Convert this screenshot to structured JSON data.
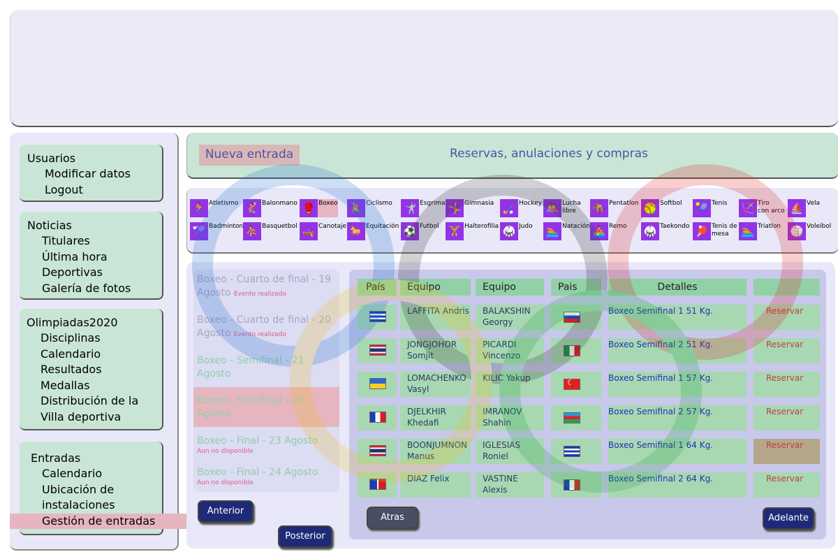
{
  "page_title": "Reservas, anulaciones y compras",
  "nueva_entrada": "Nueva entrada",
  "sidebar": {
    "usuarios": {
      "title": "Usuarios",
      "items": [
        "Modificar datos",
        "Logout"
      ]
    },
    "noticias": {
      "title": "Noticias",
      "items": [
        "Titulares",
        "Última hora",
        "Deportivas",
        "Galería de fotos"
      ]
    },
    "olimpiadas": {
      "title": "Olimpiadas2020",
      "items": [
        "Disciplinas",
        "Calendario",
        "Resultados",
        "Medallas",
        "Distribución de la",
        "Villa deportiva"
      ]
    },
    "entradas": {
      "title": "Entradas",
      "items": [
        "Calendario",
        "Ubicación de",
        "instalaciones",
        "Gestión de entradas"
      ],
      "selected_index": 3
    }
  },
  "sports_row1": [
    {
      "icon": "athletics-icon",
      "glyph": "🏃",
      "label": "Atletismo",
      "label2": ""
    },
    {
      "icon": "handball-icon",
      "glyph": "🤾",
      "label": "Balonmano",
      "label2": ""
    },
    {
      "icon": "boxing-icon",
      "glyph": "🥊",
      "label": "Boxeo",
      "label2": "",
      "selected": true
    },
    {
      "icon": "cycling-icon",
      "glyph": "🚴",
      "label": "Ciclismo",
      "label2": ""
    },
    {
      "icon": "fencing-icon",
      "glyph": "🤺",
      "label": "Esgrima",
      "label2": ""
    },
    {
      "icon": "gymnastics-icon",
      "glyph": "🤸",
      "label": "Gimnasia",
      "label2": ""
    },
    {
      "icon": "hockey-icon",
      "glyph": "🏑",
      "label": "Hockey",
      "label2": ""
    },
    {
      "icon": "wrestling-icon",
      "glyph": "🤼",
      "label": "Lucha",
      "label2": "libre"
    },
    {
      "icon": "pentathlon-icon",
      "glyph": "🏇",
      "label": "Pentatlon",
      "label2": ""
    },
    {
      "icon": "softball-icon",
      "glyph": "🥎",
      "label": "Softbol",
      "label2": ""
    },
    {
      "icon": "tennis-icon",
      "glyph": "🎾",
      "label": "Tenis",
      "label2": ""
    },
    {
      "icon": "archery-icon",
      "glyph": "🏹",
      "label": "Tiro",
      "label2": "con arco"
    },
    {
      "icon": "sailing-icon",
      "glyph": "⛵",
      "label": "Vela",
      "label2": ""
    }
  ],
  "sports_row2": [
    {
      "icon": "badminton-icon",
      "glyph": "🏸",
      "label": "Badminton",
      "label2": ""
    },
    {
      "icon": "basketball-icon",
      "glyph": "⛹",
      "label": "Basquetbol",
      "label2": ""
    },
    {
      "icon": "canoeing-icon",
      "glyph": "🛶",
      "label": "Canotaje",
      "label2": ""
    },
    {
      "icon": "equestrian-icon",
      "glyph": "🐎",
      "label": "Equitación",
      "label2": ""
    },
    {
      "icon": "football-icon",
      "glyph": "⚽",
      "label": "Futbol",
      "label2": ""
    },
    {
      "icon": "weightlifting-icon",
      "glyph": "🏋",
      "label": "Halterofilia",
      "label2": ""
    },
    {
      "icon": "judo-icon",
      "glyph": "🥋",
      "label": "Judo",
      "label2": ""
    },
    {
      "icon": "swimming-icon",
      "glyph": "🏊",
      "label": "Natación",
      "label2": ""
    },
    {
      "icon": "rowing-icon",
      "glyph": "🚣",
      "label": "Remo",
      "label2": ""
    },
    {
      "icon": "taekwondo-icon",
      "glyph": "🥋",
      "label": "Taekondo",
      "label2": ""
    },
    {
      "icon": "table-tennis-icon",
      "glyph": "🏓",
      "label": "Tenis de",
      "label2": "mesa"
    },
    {
      "icon": "triathlon-icon",
      "glyph": "🏊",
      "label": "Triatlon",
      "label2": ""
    },
    {
      "icon": "volleyball-icon",
      "glyph": "🏐",
      "label": "Voleibol",
      "label2": ""
    }
  ],
  "events": [
    {
      "l1": "Boxeo - Cuarto de final - 19",
      "l2": "Agosto",
      "tag": "Evento realizado",
      "state": "past"
    },
    {
      "l1": "Boxeo - Cuarto de final - 20",
      "l2": "Agosto",
      "tag": "Evento realizado",
      "state": "past"
    },
    {
      "l1": "Boxeo - Semifinal - 21",
      "l2": "Agosto",
      "tag": "",
      "state": "open"
    },
    {
      "l1": "Boxeo - Semifinal - 22",
      "l2": "Agosto",
      "tag": "",
      "state": "selected"
    },
    {
      "l1": "Boxeo - Final - 23 Agosto",
      "l2": "",
      "tag": "Aun no disponible",
      "state": "future"
    },
    {
      "l1": "Boxeo - Final - 24 Agosto",
      "l2": "",
      "tag": "Aun no disponible",
      "state": "future"
    }
  ],
  "buttons": {
    "anterior": "Anterior",
    "posterior": "Posterior",
    "atras": "Atras",
    "adelante": "Adelante"
  },
  "table": {
    "headers": [
      "País",
      "Equipo",
      "Equipo",
      "Pais",
      "Detalles"
    ],
    "rows": [
      {
        "flag1": "cuba",
        "team1": [
          "LAFFITA Andris",
          ""
        ],
        "team2": [
          "BALAKSHIN",
          "Georgy"
        ],
        "flag2": "russia",
        "detail": "Boxeo Semifinal 1 51 Kg.",
        "action": "Reservar"
      },
      {
        "flag1": "thailand",
        "team1": [
          "JONGJOHOR",
          "Somjit"
        ],
        "team2": [
          "PICARDI",
          "Vincenzo"
        ],
        "flag2": "italy",
        "detail": "Boxeo Semifinal 2 51 Kg.",
        "action": "Reservar"
      },
      {
        "flag1": "ukraine",
        "team1": [
          "LOMACHENKO",
          "Vasyl"
        ],
        "team2": [
          "KILIC Yakup",
          ""
        ],
        "flag2": "turkey",
        "detail": "Boxeo Semifinal 1 57 Kg.",
        "action": "Reservar"
      },
      {
        "flag1": "france",
        "team1": [
          "DJELKHIR",
          "Khedafi"
        ],
        "team2": [
          "IMRANOV",
          "Shahin"
        ],
        "flag2": "azerbaijan",
        "detail": "Boxeo Semifinal 2 57 Kg.",
        "action": "Reservar"
      },
      {
        "flag1": "thailand",
        "team1": [
          "BOONJUMNON",
          "Manus"
        ],
        "team2": [
          "IGLESIAS",
          "Roniel"
        ],
        "flag2": "cuba",
        "detail": "Boxeo Semifinal 1 64 Kg.",
        "action": "Reservar",
        "highlight": true
      },
      {
        "flag1": "dominican",
        "team1": [
          "DIAZ Felix",
          ""
        ],
        "team2": [
          "VASTINE",
          "Alexis"
        ],
        "flag2": "france",
        "detail": "Boxeo Semifinal 2 64 Kg.",
        "action": "Reservar"
      }
    ]
  }
}
